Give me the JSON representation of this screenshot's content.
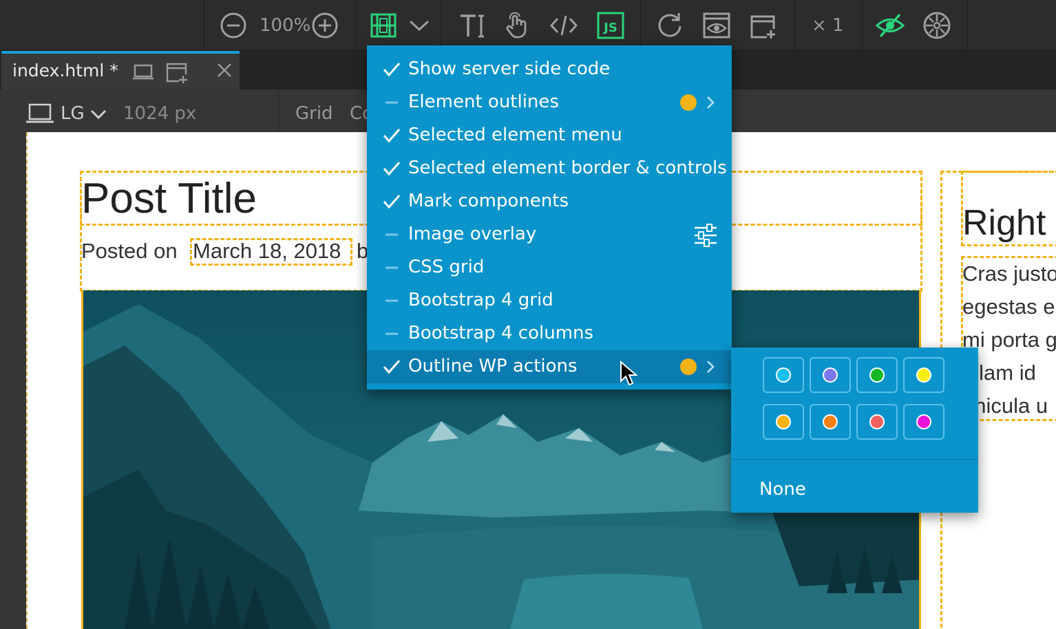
{
  "toolbar": {
    "zoom_level": "100%",
    "multiplier": "× 1",
    "icons": [
      "zoom-out-icon",
      "zoom-in-icon",
      "outline-view-icon",
      "chevron-down-icon",
      "text-tool-icon",
      "touch-icon",
      "code-icon",
      "js-icon",
      "refresh-icon",
      "preview-icon",
      "add-page-icon",
      "visibility-icon",
      "debug-icon"
    ]
  },
  "tabs": [
    {
      "label": "index.html *"
    }
  ],
  "device": {
    "size_label": "LG",
    "width_label": "1024 px",
    "grid_label": "Grid",
    "partial_label": "Co"
  },
  "page": {
    "post_title": "Post Title",
    "posted_prefix": "Posted on",
    "date": "March 18, 2018",
    "posted_suffix": "b",
    "right_title": "Right",
    "right_lines": [
      "Cras justo",
      "egestas e",
      "mi porta g",
      "ullam id",
      "ehicula u"
    ]
  },
  "menu": {
    "items": [
      {
        "label": "Show server side code",
        "state": "checked"
      },
      {
        "label": "Element outlines",
        "state": "dash",
        "dot_color": "#f2b316",
        "has_submenu": true
      },
      {
        "label": "Selected element menu",
        "state": "checked"
      },
      {
        "label": "Selected element border & controls",
        "state": "checked"
      },
      {
        "label": "Mark components",
        "state": "checked"
      },
      {
        "label": "Image overlay",
        "state": "dash",
        "has_settings": true
      },
      {
        "label": "CSS grid",
        "state": "dash"
      },
      {
        "label": "Bootstrap 4 grid",
        "state": "dash"
      },
      {
        "label": "Bootstrap 4 columns",
        "state": "dash"
      },
      {
        "label": "Outline WP actions",
        "state": "checked",
        "dot_color": "#f2b316",
        "has_submenu": true,
        "active": true
      }
    ]
  },
  "color_submenu": {
    "colors": [
      "#17c0f0",
      "#7b78f0",
      "#16b826",
      "#f6ee11",
      "#f7b314",
      "#f77f14",
      "#f25f5f",
      "#e812d8"
    ],
    "none_label": "None"
  },
  "theme": {
    "menu_bg": "#0a94cb",
    "active_bg": "#0b7cb0",
    "accent_green": "#2ad57a",
    "outline_yellow": "#f2b316"
  }
}
